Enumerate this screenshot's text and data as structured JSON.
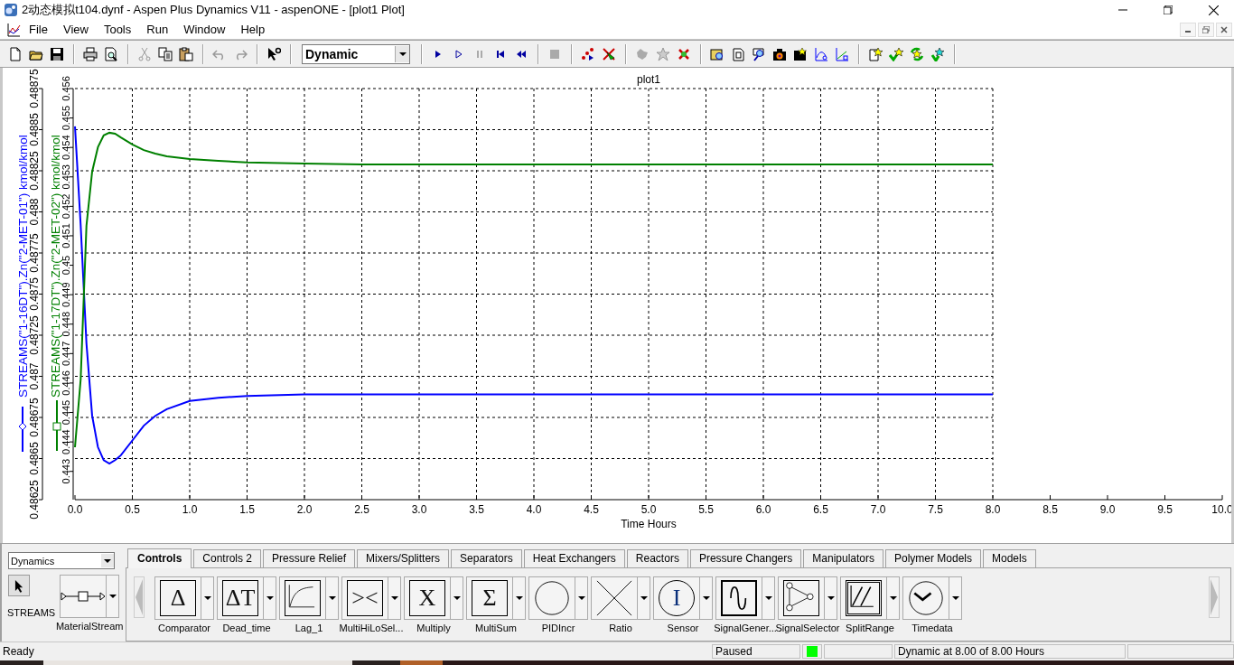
{
  "window": {
    "title": "2动态模拟t104.dynf - Aspen Plus Dynamics V11 - aspenONE - [plot1 Plot]"
  },
  "menu": [
    "File",
    "View",
    "Tools",
    "Run",
    "Window",
    "Help"
  ],
  "toolbar": {
    "mode_select": "Dynamic"
  },
  "plot": {
    "title": "plot1",
    "chart_data": {
      "type": "line",
      "grid": true,
      "xlabel": "Time Hours",
      "x": [
        0,
        0.05,
        0.1,
        0.15,
        0.2,
        0.25,
        0.3,
        0.35,
        0.4,
        0.5,
        0.6,
        0.7,
        0.8,
        1,
        1.25,
        1.5,
        2,
        2.5,
        3,
        4,
        5,
        6,
        7,
        8
      ],
      "series": [
        {
          "name": "STREAMS(\"1-16DT\").Zn(\"2-MET-01\") kmol/kmol",
          "color": "#0000ff",
          "axis": "y",
          "values": [
            0.48852,
            0.48792,
            0.4872,
            0.48676,
            0.48657,
            0.48649,
            0.48647,
            0.48649,
            0.48652,
            0.48661,
            0.4867,
            0.48676,
            0.4868,
            0.48685,
            0.48687,
            0.48688,
            0.48689,
            0.48689,
            0.48689,
            0.48689,
            0.48689,
            0.48689,
            0.48689,
            0.48689
          ]
        },
        {
          "name": "STREAMS(\"1-17DT\").Zn(\"2-MET-02\") kmol/kmol",
          "color": "#008000",
          "axis": "y2",
          "values": [
            0.44382,
            0.44612,
            0.45134,
            0.45318,
            0.45401,
            0.45441,
            0.4545,
            0.45447,
            0.45434,
            0.4541,
            0.45391,
            0.45379,
            0.4537,
            0.45361,
            0.45355,
            0.45349,
            0.45345,
            0.45342,
            0.45342,
            0.45342,
            0.45342,
            0.45342,
            0.45342,
            0.45342
          ]
        }
      ],
      "xlim": [
        0,
        10
      ],
      "xticks": [
        {
          "value": 0,
          "label": "0.0"
        },
        {
          "value": 0.5,
          "label": "0.5"
        },
        {
          "value": 1,
          "label": "1.0"
        },
        {
          "value": 1.5,
          "label": "1.5"
        },
        {
          "value": 2,
          "label": "2.0"
        },
        {
          "value": 2.5,
          "label": "2.5"
        },
        {
          "value": 3,
          "label": "3.0"
        },
        {
          "value": 3.5,
          "label": "3.5"
        },
        {
          "value": 4,
          "label": "4.0"
        },
        {
          "value": 4.5,
          "label": "4.5"
        },
        {
          "value": 5,
          "label": "5.0"
        },
        {
          "value": 5.5,
          "label": "5.5"
        },
        {
          "value": 6,
          "label": "6.0"
        },
        {
          "value": 6.5,
          "label": "6.5"
        },
        {
          "value": 7,
          "label": "7.0"
        },
        {
          "value": 7.5,
          "label": "7.5"
        },
        {
          "value": 8,
          "label": "8.0"
        },
        {
          "value": 8.5,
          "label": "8.5"
        },
        {
          "value": 9,
          "label": "9.0"
        },
        {
          "value": 9.5,
          "label": "9.5"
        },
        {
          "value": 10,
          "label": "10.0"
        }
      ],
      "ylim": [
        0.48625,
        0.48875
      ],
      "yticks": [
        0.48625,
        0.4865,
        0.48675,
        0.487,
        0.48725,
        0.4875,
        0.48775,
        0.488,
        0.48825,
        0.4885,
        0.48875
      ],
      "y2lim": [
        0.44204,
        0.456
      ],
      "y2ticks": [
        0.443,
        0.444,
        0.445,
        0.446,
        0.447,
        0.448,
        0.449,
        0.45,
        0.451,
        0.452,
        0.453,
        0.454,
        0.455,
        0.456
      ]
    }
  },
  "palette": {
    "library": "Dynamics",
    "stream_label": "STREAMS",
    "stream_item": "MaterialStream",
    "tabs": [
      {
        "label": "Controls",
        "selected": true
      },
      {
        "label": "Controls 2",
        "selected": false
      },
      {
        "label": "Pressure Relief",
        "selected": false
      },
      {
        "label": "Mixers/Splitters",
        "selected": false
      },
      {
        "label": "Separators",
        "selected": false
      },
      {
        "label": "Heat Exchangers",
        "selected": false
      },
      {
        "label": "Reactors",
        "selected": false
      },
      {
        "label": "Pressure Changers",
        "selected": false
      },
      {
        "label": "Manipulators",
        "selected": false
      },
      {
        "label": "Polymer Models",
        "selected": false
      },
      {
        "label": "Models",
        "selected": false
      }
    ],
    "blocks": [
      {
        "label": "Comparator",
        "kind": "glyph",
        "glyph": "Δ"
      },
      {
        "label": "Dead_time",
        "kind": "glyph",
        "glyph": "ΔT"
      },
      {
        "label": "Lag_1",
        "kind": "lag"
      },
      {
        "label": "MultiHiLoSel...",
        "kind": "glyph",
        "glyph": "><"
      },
      {
        "label": "Multiply",
        "kind": "glyph",
        "glyph": "X"
      },
      {
        "label": "MultiSum",
        "kind": "glyph",
        "glyph": "Σ"
      },
      {
        "label": "PIDIncr",
        "kind": "circle"
      },
      {
        "label": "Ratio",
        "kind": "cross"
      },
      {
        "label": "Sensor",
        "kind": "sensor",
        "glyph": "I"
      },
      {
        "label": "SignalGener...",
        "kind": "sine"
      },
      {
        "label": "SignalSelector",
        "kind": "selector"
      },
      {
        "label": "SplitRange",
        "kind": "split"
      },
      {
        "label": "Timedata",
        "kind": "clock"
      }
    ]
  },
  "status_bar": {
    "message": "Ready",
    "run_state": "Paused",
    "progress": "Dynamic at 8.00 of 8.00 Hours"
  }
}
